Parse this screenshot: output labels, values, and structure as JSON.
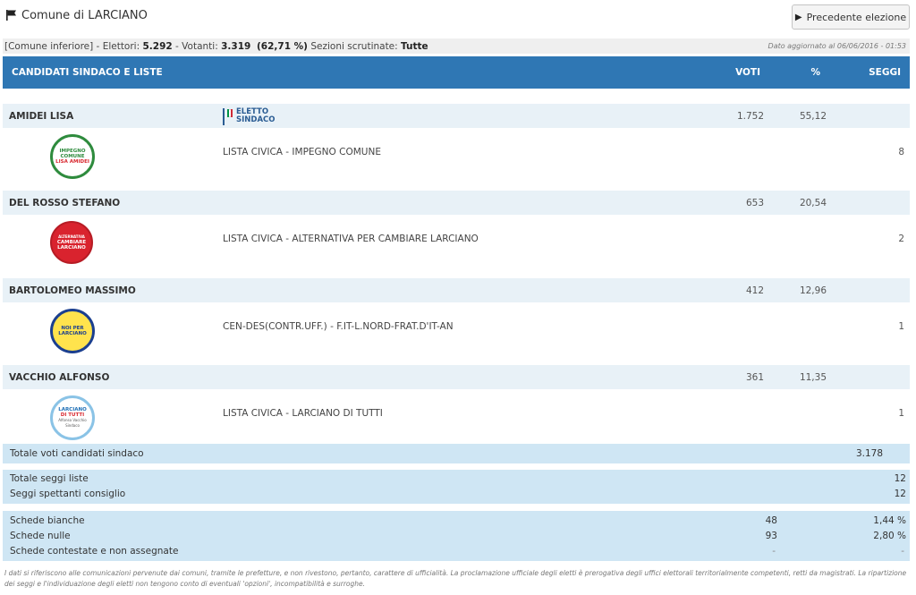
{
  "header": {
    "title": "Comune di LARCIANO",
    "prev_button": "Precedente elezione"
  },
  "info_bar": {
    "scope": "[Comune inferiore]",
    "elettori_label": "Elettori:",
    "elettori_value": "5.292",
    "votanti_label": "Votanti:",
    "votanti_value": "3.319",
    "votanti_pct": "(62,71 %)",
    "sezioni_label": "Sezioni scrutinate:",
    "sezioni_value": "Tutte",
    "updated": "Dato aggiornato al 06/06/2016 - 01:53"
  },
  "table_header": {
    "name": "CANDIDATI SINDACO E LISTE",
    "voti": "VOTI",
    "pct": "%",
    "seggi": "SEGGI"
  },
  "eletto_badge": {
    "line1": "ELETTO",
    "line2": "SINDACO"
  },
  "candidates": [
    {
      "name": "AMIDEI LISA",
      "voti": "1.752",
      "pct": "55,12",
      "elected": true,
      "list": {
        "name": "LISTA CIVICA - IMPEGNO COMUNE",
        "seggi": "8",
        "logo": {
          "text": [
            "IMPEGNO",
            "COMUNE",
            "LISA AMIDEI"
          ],
          "bg": "#ffffff",
          "ring": "#2e8b3d",
          "accent": "#d8282f"
        }
      }
    },
    {
      "name": "DEL ROSSO STEFANO",
      "voti": "653",
      "pct": "20,54",
      "elected": false,
      "list": {
        "name": "LISTA CIVICA - ALTERNATIVA PER CAMBIARE LARCIANO",
        "seggi": "2",
        "logo": {
          "text": [
            "ALTERNATIVA",
            "CAMBIARE",
            "LARCIANO"
          ],
          "bg": "#d9232e",
          "ring": "#b71c25",
          "accent": "#ffffff"
        }
      }
    },
    {
      "name": "BARTOLOMEO MASSIMO",
      "voti": "412",
      "pct": "12,96",
      "elected": false,
      "list": {
        "name": "CEN-DES(CONTR.UFF.) - F.IT-L.NORD-FRAT.D'IT-AN",
        "seggi": "1",
        "logo": {
          "text": [
            "NOI PER",
            "LARCIANO"
          ],
          "bg": "#ffe34d",
          "ring": "#1b3f8f",
          "accent": "#1b3f8f"
        }
      }
    },
    {
      "name": "VACCHIO ALFONSO",
      "voti": "361",
      "pct": "11,35",
      "elected": false,
      "list": {
        "name": "LISTA CIVICA - LARCIANO DI TUTTI",
        "seggi": "1",
        "logo": {
          "text": [
            "LARCIANO",
            "DI TUTTI",
            "Alfonso Vacchio",
            "Sindaco"
          ],
          "bg": "#ffffff",
          "ring": "#8ac3e6",
          "accent": "#1e6fb6"
        }
      }
    }
  ],
  "totals": {
    "voti_candidati_label": "Totale voti candidati sindaco",
    "voti_candidati_value": "3.178",
    "seggi_liste_label": "Totale seggi liste",
    "seggi_liste_value": "12",
    "seggi_consiglio_label": "Seggi spettanti consiglio",
    "seggi_consiglio_value": "12",
    "bianche_label": "Schede bianche",
    "bianche_value": "48",
    "bianche_pct": "1,44 %",
    "nulle_label": "Schede nulle",
    "nulle_value": "93",
    "nulle_pct": "2,80 %",
    "contestate_label": "Schede contestate e non assegnate",
    "contestate_value": "-",
    "contestate_pct": "-"
  },
  "disclaimer": "I dati si riferiscono alle comunicazioni pervenute dai comuni, tramite le prefetture, e non rivestono, pertanto, carattere di ufficialità. La proclamazione ufficiale degli eletti è prerogativa degli uffici elettorali territorialmente competenti, retti da magistrati. La ripartizione dei seggi e l'individuazione degli eletti non tengono conto di eventuali 'opzioni', incompatibilità e surroghe.",
  "colors": {
    "header_blue": "#2f77b4",
    "row_blue": "#e8f1f7",
    "summary_blue": "#cfe6f4"
  },
  "icons": {
    "flag": "flag-icon",
    "chevron": "chevron-right-icon"
  }
}
